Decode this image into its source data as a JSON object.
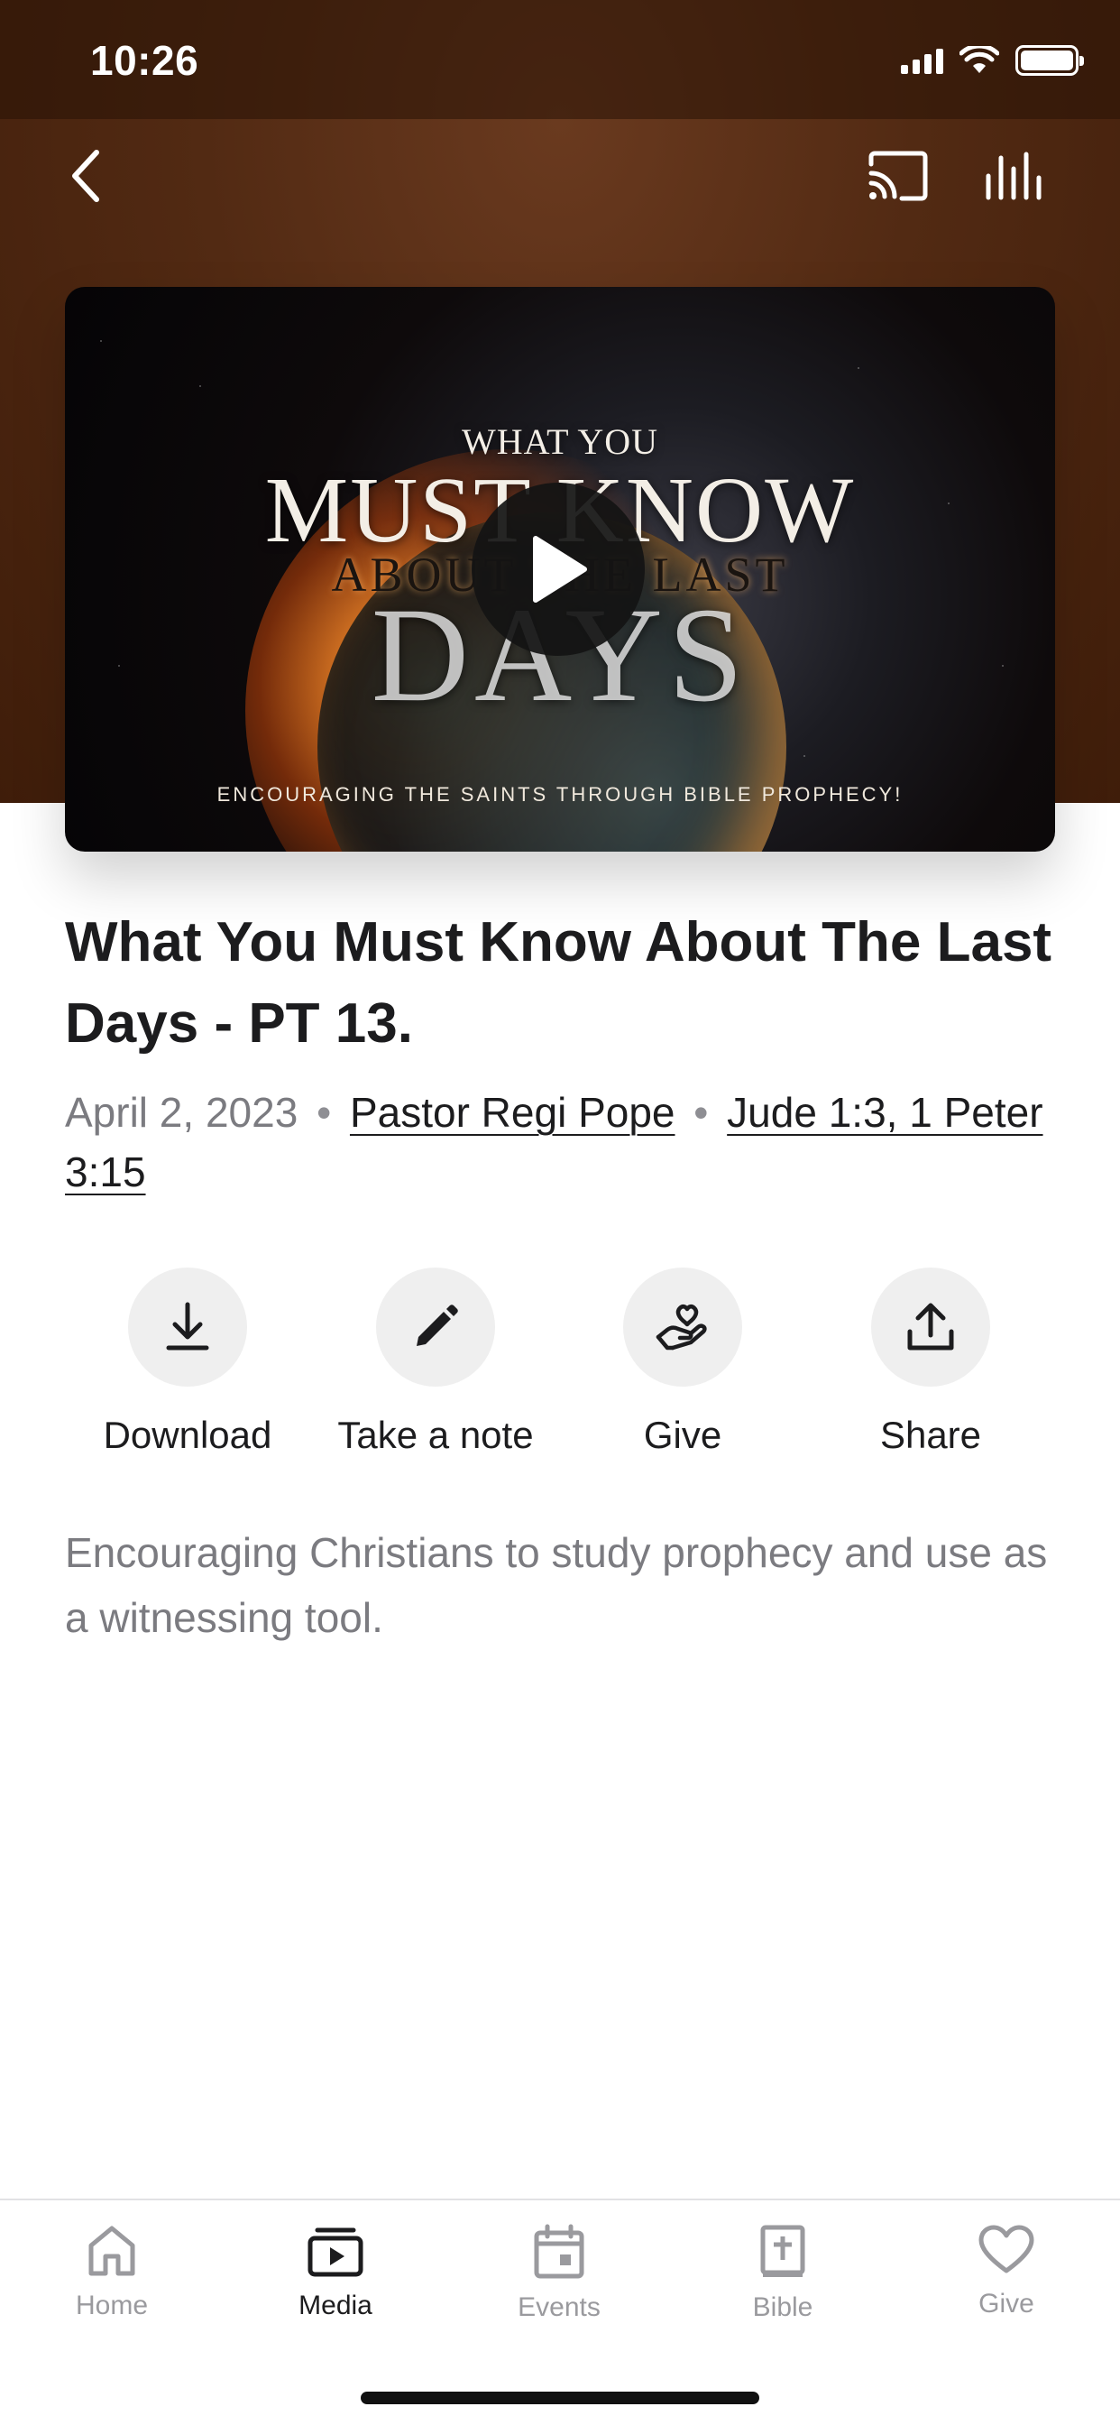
{
  "status_bar": {
    "time": "10:26"
  },
  "header": {
    "back_icon": "chevron-left-icon",
    "cast_icon": "cast-icon",
    "equalizer_icon": "equalizer-icon",
    "background_color": "#522a13"
  },
  "video": {
    "poster_line1": "WHAT YOU",
    "poster_line2": "MUST KNOW",
    "poster_line3": "ABOUT THE LAST",
    "poster_line4": "DAYS",
    "poster_tagline": "ENCOURAGING THE SAINTS THROUGH BIBLE PROPHECY!",
    "play_icon": "play-icon"
  },
  "sermon": {
    "title": "What You Must Know About The Last Days - PT 13.",
    "date": "April 2, 2023",
    "separator": "•",
    "speaker": "Pastor Regi Pope",
    "scripture": "Jude 1:3, 1 Peter 3:15",
    "description": "Encouraging Christians to study prophecy and use as a witnessing tool."
  },
  "actions": [
    {
      "label": "Download",
      "icon": "download-icon"
    },
    {
      "label": "Take a note",
      "icon": "pencil-icon"
    },
    {
      "label": "Give",
      "icon": "giving-hand-heart-icon"
    },
    {
      "label": "Share",
      "icon": "share-upload-icon"
    }
  ],
  "tab_bar": {
    "active": "Media",
    "tabs": [
      {
        "label": "Home",
        "icon": "home-icon"
      },
      {
        "label": "Media",
        "icon": "media-player-icon"
      },
      {
        "label": "Events",
        "icon": "calendar-icon"
      },
      {
        "label": "Bible",
        "icon": "bible-icon"
      },
      {
        "label": "Give",
        "icon": "heart-icon"
      }
    ]
  }
}
